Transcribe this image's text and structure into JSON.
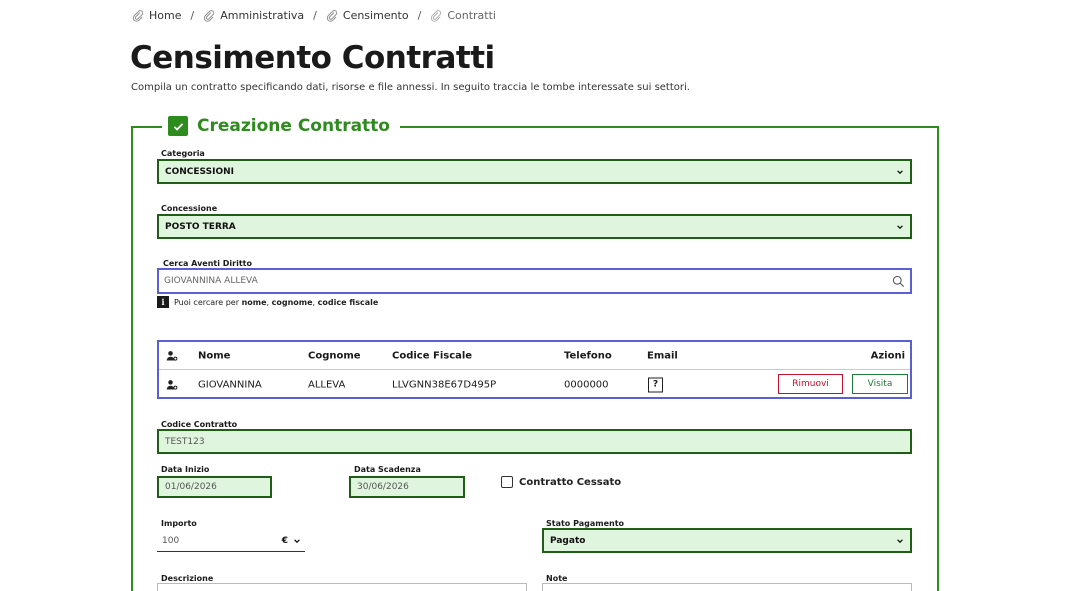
{
  "breadcrumb": [
    {
      "label": "Home"
    },
    {
      "label": "Amministrativa"
    },
    {
      "label": "Censimento"
    },
    {
      "label": "Contratti"
    }
  ],
  "page": {
    "title": "Censimento Contratti",
    "subtitle": "Compila un contratto specificando dati, risorse e file annessi. In seguito traccia le tombe interessate sui settori."
  },
  "form": {
    "legend": "Creazione Contratto",
    "categoria": {
      "label": "Categoria",
      "value": "CONCESSIONI"
    },
    "concessione": {
      "label": "Concessione",
      "value": "POSTO TERRA"
    },
    "search": {
      "label": "Cerca Aventi Diritto",
      "value": "GIOVANNINA ALLEVA"
    },
    "hint": {
      "prefix": "Puoi cercare per ",
      "nome": "nome",
      "sep1": ", ",
      "cognome": "cognome",
      "sep2": ", ",
      "cf": "codice fiscale"
    },
    "table": {
      "headers": {
        "nome": "Nome",
        "cognome": "Cognome",
        "cf": "Codice Fiscale",
        "telefono": "Telefono",
        "email": "Email",
        "azioni": "Azioni"
      },
      "rows": [
        {
          "nome": "GIOVANNINA",
          "cognome": "ALLEVA",
          "cf": "LLVGNN38E67D495P",
          "telefono": "0000000",
          "email": "?",
          "remove_label": "Rimuovi",
          "visit_label": "Visita"
        }
      ]
    },
    "codice_contratto": {
      "label": "Codice Contratto",
      "value": "TEST123"
    },
    "data_inizio": {
      "label": "Data Inizio",
      "value": "01/06/2026"
    },
    "data_scadenza": {
      "label": "Data Scadenza",
      "value": "30/06/2026"
    },
    "cessato": {
      "label": "Contratto Cessato",
      "checked": false
    },
    "importo": {
      "label": "Importo",
      "value": "100",
      "currency": "€"
    },
    "stato_pagamento": {
      "label": "Stato Pagamento",
      "value": "Pagato"
    },
    "descrizione": {
      "label": "Descrizione"
    },
    "note": {
      "label": "Note"
    }
  },
  "colors": {
    "accent": "#2e8b1e",
    "border_dark": "#1f5e14",
    "field_bg": "#dff5dd",
    "focus": "#5b5fd6",
    "danger": "#c8102e"
  }
}
